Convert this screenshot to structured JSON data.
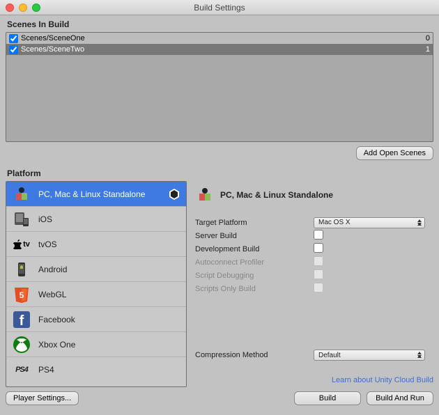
{
  "window": {
    "title": "Build Settings"
  },
  "scenes": {
    "heading": "Scenes In Build",
    "items": [
      {
        "path": "Scenes/SceneOne",
        "index": "0",
        "checked": true,
        "selected": false
      },
      {
        "path": "Scenes/SceneTwo",
        "index": "1",
        "checked": true,
        "selected": true
      }
    ],
    "add_open_label": "Add Open Scenes"
  },
  "platform": {
    "heading": "Platform",
    "items": [
      {
        "label": "PC, Mac & Linux Standalone",
        "icon": "standalone",
        "selected": true,
        "current": true
      },
      {
        "label": "iOS",
        "icon": "ios",
        "selected": false
      },
      {
        "label": "tvOS",
        "icon": "tvos",
        "selected": false
      },
      {
        "label": "Android",
        "icon": "android",
        "selected": false
      },
      {
        "label": "WebGL",
        "icon": "webgl",
        "selected": false
      },
      {
        "label": "Facebook",
        "icon": "facebook",
        "selected": false
      },
      {
        "label": "Xbox One",
        "icon": "xbox",
        "selected": false
      },
      {
        "label": "PS4",
        "icon": "ps4",
        "selected": false
      }
    ]
  },
  "details": {
    "title": "PC, Mac & Linux Standalone",
    "target_platform": {
      "label": "Target Platform",
      "value": "Mac OS X"
    },
    "server_build": {
      "label": "Server Build",
      "checked": false
    },
    "dev_build": {
      "label": "Development Build",
      "checked": false
    },
    "autoconnect": {
      "label": "Autoconnect Profiler",
      "checked": false
    },
    "script_debug": {
      "label": "Script Debugging",
      "checked": false
    },
    "scripts_only": {
      "label": "Scripts Only Build",
      "checked": false
    },
    "compression": {
      "label": "Compression Method",
      "value": "Default"
    },
    "learn_link": "Learn about Unity Cloud Build"
  },
  "footer": {
    "player_settings": "Player Settings...",
    "build": "Build",
    "build_and_run": "Build And Run"
  }
}
